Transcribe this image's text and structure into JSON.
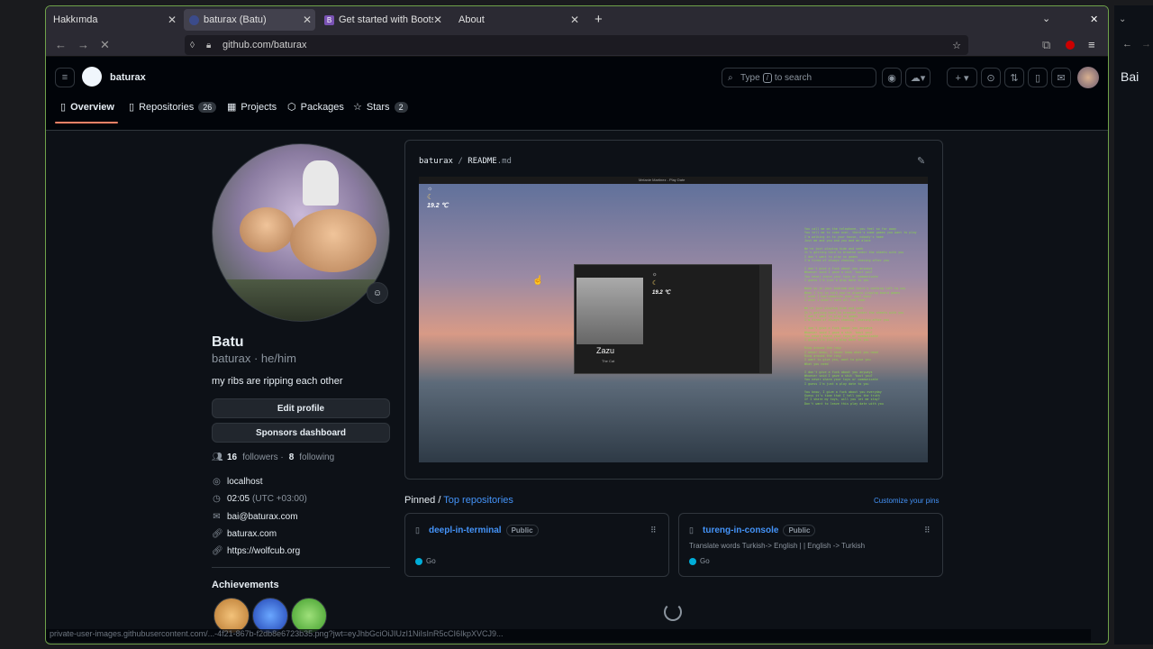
{
  "browser": {
    "tabs": [
      {
        "label": "Hakkımda"
      },
      {
        "label": "baturax (Batu)"
      },
      {
        "label": "Get started with Bootstr"
      },
      {
        "label": "About"
      }
    ],
    "url": "github.com/baturax",
    "status_url": "private-user-images.githubusercontent.com/...-4f21-867b-f2db8e6723b35.png?jwt=eyJhbGciOiJIUzI1NiIsInR5cCI6IkpXVCJ9..."
  },
  "header": {
    "username": "baturax",
    "search_placeholder_prefix": "Type",
    "search_key": "/",
    "search_placeholder_suffix": "to search",
    "nav": [
      {
        "label": "Overview"
      },
      {
        "label": "Repositories",
        "count": "26"
      },
      {
        "label": "Projects"
      },
      {
        "label": "Packages"
      },
      {
        "label": "Stars",
        "count": "2"
      }
    ]
  },
  "profile": {
    "name": "Batu",
    "handle": "baturax · he/him",
    "bio": "my ribs are ripping each other",
    "edit_button": "Edit profile",
    "sponsors_button": "Sponsors dashboard",
    "followers_count": "16",
    "followers_label": "followers ·",
    "following_count": "8",
    "following_label": "following",
    "location": "localhost",
    "time": "02:05",
    "timezone": "(UTC +03:00)",
    "email": "bai@baturax.com",
    "website": "baturax.com",
    "link": "https://wolfcub.org",
    "achievements_title": "Achievements"
  },
  "readme": {
    "path_user": "baturax",
    "path_sep": "/",
    "path_file": "README",
    "path_ext": ".md",
    "weather_temp": "19.2 ℃",
    "player_temp": "19.2 ℃",
    "player_name": "Zazu",
    "player_sub": "The Cat",
    "top_title": "Melanie Martinez - Play Date",
    "lyrics": "You call me on the telephone, you feel so far away\nYou tell me to come over, there's some games you want to play\nI'm walking in to your house, nobody's home\nJust me and you and you and me alone\n\nWe're just playing hide and seek\nIt's getting hard to breathe under the sheets with you\nI don't want to play no games\nI'm tired of always chasing, chasing after you\n\nI don't give a fuck about you anyways\nWhoever said I gave a shit 'bout you?\nYou never share your toys or communicate\nI guess I'm just a play date to you\n\nWake up in your bedroom and there's nothing left to say\nWhen I try to talk you're always playing board games\nI wish I had memories over your mind\nI wish I didn't care all the time\n\nWe're just playing hide and seek\nIt's getting hard to breathe under the sheets with you\nI don't want to play no games\nI'm tired of always chasing, chasing after you\n\nI don't give a fuck about you anyways\nWhoever said I gave a shit 'bout you?\nYou never share your toys or communicate\nI guess I'm just a play date to you\n\nRing around the rosy\nI never know, I never know what you need\nRing around the rosy\nI want to give you, want to give you\nWhat you need\n\nI don't give a fuck about you anyways\nWhoever said I gave a shit 'bout you?\nYou never share your toys or communicate\nI guess I'm just a play date to you\n\nYou know, I give a fuck about you everyday\nGuess it's time that I tell you the truth\nIf I share my toys, will you let me stay?\nDon't want to leave this play date with you"
  },
  "pinned": {
    "title": "Pinned",
    "sep": "/",
    "top_link": "Top repositories",
    "customize": "Customize your pins",
    "repos": [
      {
        "name": "deepl-in-terminal",
        "visibility": "Public",
        "description": "",
        "language": "Go"
      },
      {
        "name": "tureng-in-console",
        "visibility": "Public",
        "description": "Translate words Turkish-> English | | English -> Turkish",
        "language": "Go"
      }
    ]
  },
  "side": {
    "label": "Bai"
  }
}
